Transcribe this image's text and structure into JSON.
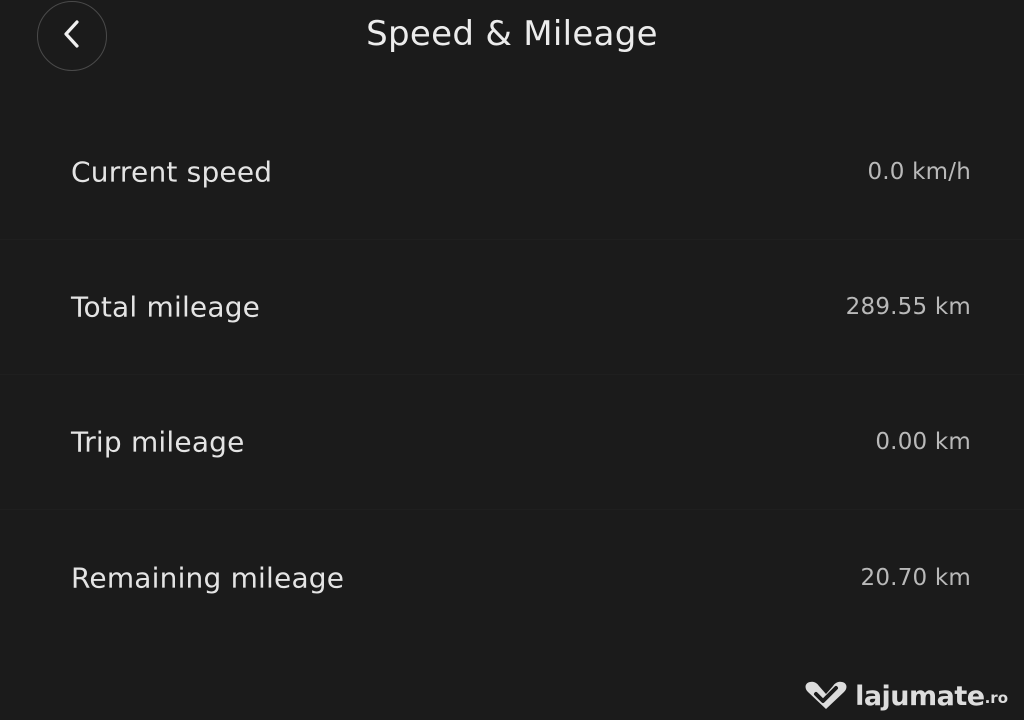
{
  "header": {
    "title": "Speed & Mileage",
    "back_icon": "chevron-left-icon"
  },
  "rows": [
    {
      "label": "Current speed",
      "value": "0.0 km/h"
    },
    {
      "label": "Total mileage",
      "value": "289.55 km"
    },
    {
      "label": "Trip mileage",
      "value": "0.00 km"
    },
    {
      "label": "Remaining mileage",
      "value": "20.70 km"
    }
  ],
  "watermark": {
    "name": "lajumate",
    "tld": ".ro",
    "logo_icon": "heart-check-logo"
  },
  "colors": {
    "background": "#1b1b1b",
    "title_text": "#ececec",
    "label_text": "#e4e4e4",
    "value_text": "#b9b9b9"
  }
}
